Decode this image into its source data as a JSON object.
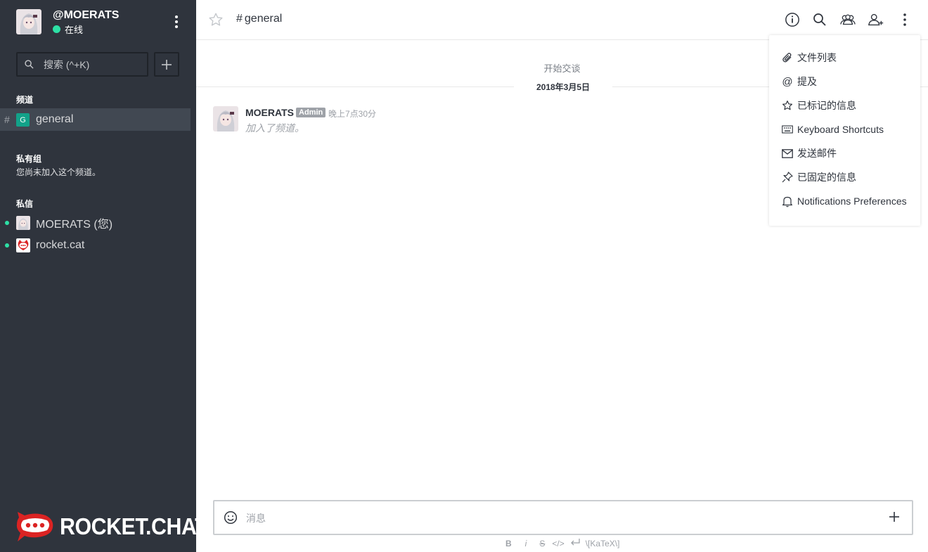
{
  "user": {
    "username": "@MOERATS",
    "status": "在线"
  },
  "sidebar": {
    "search_placeholder": "搜索 (^+K)",
    "channels_title": "频道",
    "channels": [
      {
        "name": "general",
        "initial": "G"
      }
    ],
    "groups_title": "私有组",
    "groups_note": "您尚未加入这个频道。",
    "dm_title": "私信",
    "dms": [
      {
        "name": "MOERATS (您)"
      },
      {
        "name": "rocket.cat"
      }
    ],
    "logo_text": "ROCKET.CHAT"
  },
  "header": {
    "room_name": "general"
  },
  "chat": {
    "start_label": "开始交谈",
    "date_label": "2018年3月5日",
    "messages": [
      {
        "author": "MOERATS",
        "role": "Admin",
        "time": "晚上7点30分",
        "body": "加入了频道。"
      }
    ]
  },
  "composer": {
    "placeholder": "消息",
    "format": {
      "bold": "B",
      "italic": "i",
      "strike": "S",
      "code": "</>",
      "katex": "\\[KaTeX\\]"
    }
  },
  "menu": {
    "items": [
      {
        "label": "文件列表",
        "icon": "paperclip-icon"
      },
      {
        "label": "提及",
        "icon": "at-icon"
      },
      {
        "label": "已标记的信息",
        "icon": "star-icon"
      },
      {
        "label": "Keyboard Shortcuts",
        "icon": "keyboard-icon"
      },
      {
        "label": "发送邮件",
        "icon": "mail-icon"
      },
      {
        "label": "已固定的信息",
        "icon": "pin-icon"
      },
      {
        "label": "Notifications Preferences",
        "icon": "bell-icon"
      }
    ]
  },
  "colors": {
    "sidebar_bg": "#2f343d",
    "active_room": "#414852",
    "online": "#2de0a5",
    "channel_avatar": "#12a289",
    "brand_red": "#db2323"
  }
}
